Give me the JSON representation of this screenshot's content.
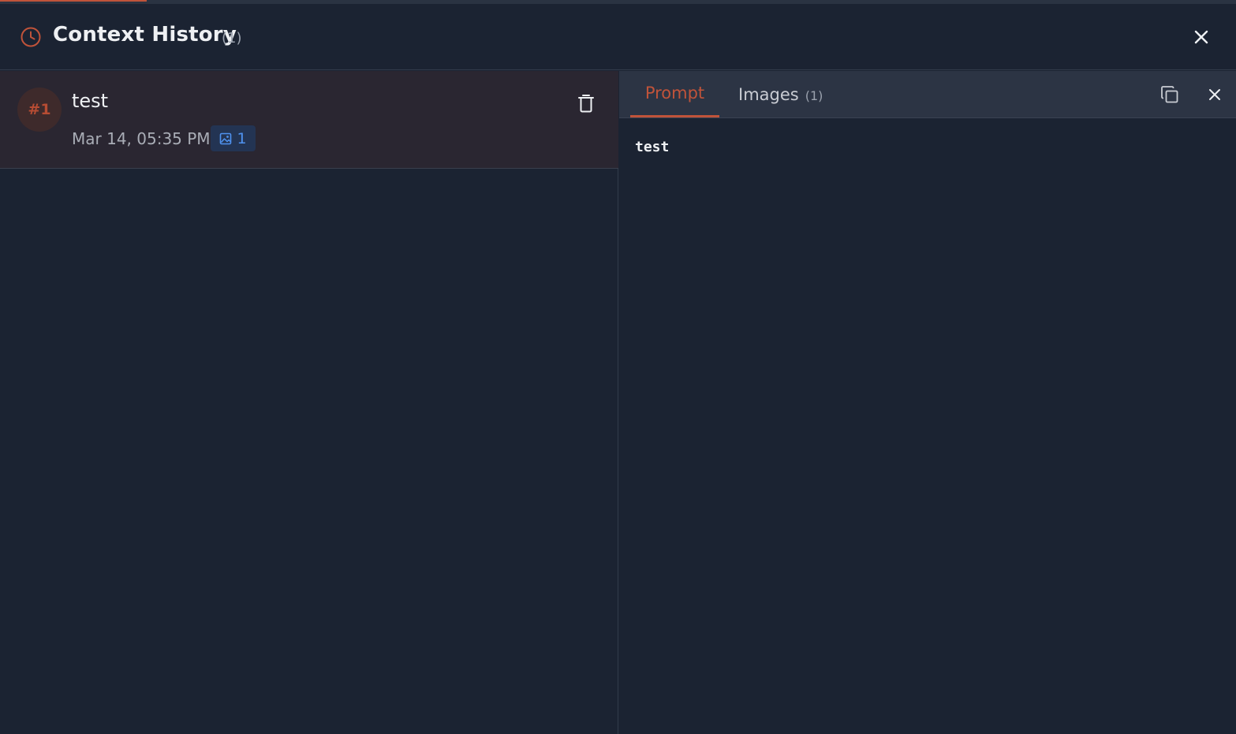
{
  "header": {
    "title": "Context History",
    "count": "(1)",
    "icon": "clock-icon",
    "close_icon": "close-icon"
  },
  "entries": [
    {
      "index": "#1",
      "name": "test",
      "date": "Mar 14, 05:35 PM",
      "image_count": "1",
      "image_icon": "image-icon",
      "delete_icon": "trash-icon"
    }
  ],
  "detail": {
    "tabs": [
      {
        "label": "Prompt",
        "active": true
      },
      {
        "label": "Images",
        "count": "(1)",
        "active": false
      }
    ],
    "copy_icon": "copy-icon",
    "close_icon": "close-icon",
    "prompt_text": "test"
  },
  "colors": {
    "background": "#1b2332",
    "accent": "#c0533a",
    "badge_blue": "#4f92ef",
    "selected_row": "#2a2631",
    "tabbar": "#2c3444"
  }
}
